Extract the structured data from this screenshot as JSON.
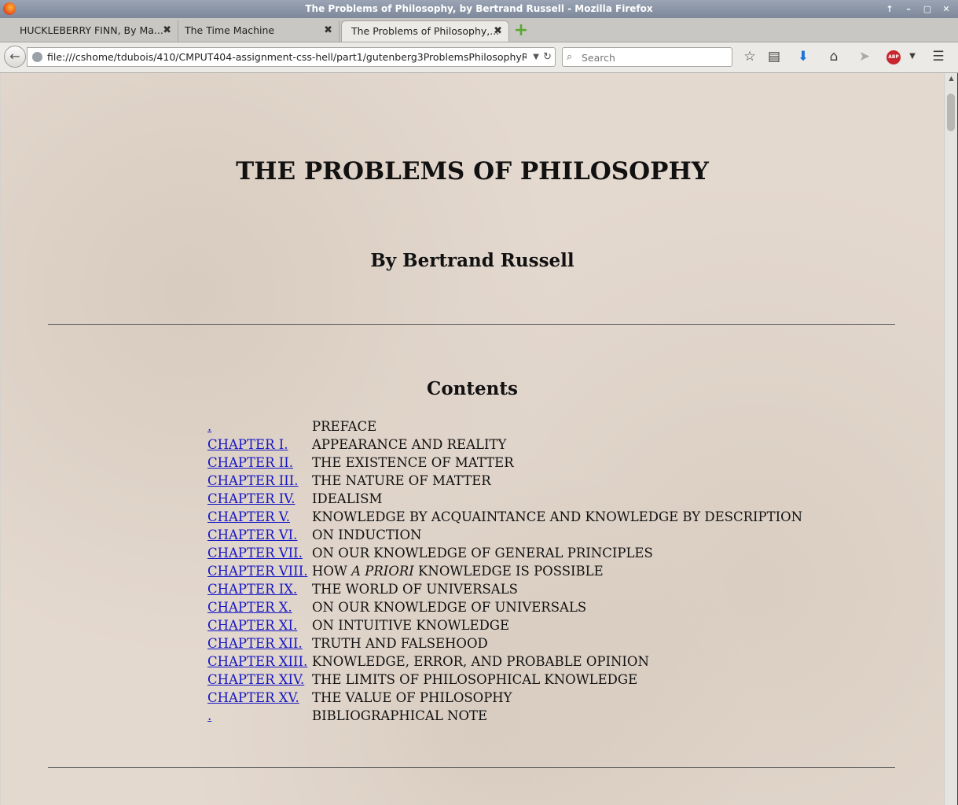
{
  "window": {
    "title": "The Problems of Philosophy, by Bertrand Russell - Mozilla Firefox"
  },
  "tabs": [
    {
      "label": "HUCKLEBERRY FINN, By Ma...",
      "active": false
    },
    {
      "label": "The Time Machine",
      "active": false
    },
    {
      "label": "The Problems of Philosophy,...",
      "active": true
    }
  ],
  "navbar": {
    "url": "file:///cshome/tdubois/410/CMPUT404-assignment-css-hell/part1/gutenberg3ProblemsPhilosophyRussell.ht",
    "search_placeholder": "Search",
    "abp_label": "ABP"
  },
  "page": {
    "title": "THE PROBLEMS OF PHILOSOPHY",
    "author": "By Bertrand Russell",
    "contents_heading": "Contents",
    "toc": [
      {
        "link": ".",
        "title_pre": "PREFACE",
        "title_em": "",
        "title_post": ""
      },
      {
        "link": "CHAPTER I.",
        "title_pre": "APPEARANCE AND REALITY",
        "title_em": "",
        "title_post": ""
      },
      {
        "link": "CHAPTER II.",
        "title_pre": "THE EXISTENCE OF MATTER",
        "title_em": "",
        "title_post": ""
      },
      {
        "link": "CHAPTER III.",
        "title_pre": "THE NATURE OF MATTER",
        "title_em": "",
        "title_post": ""
      },
      {
        "link": "CHAPTER IV.",
        "title_pre": "IDEALISM",
        "title_em": "",
        "title_post": ""
      },
      {
        "link": "CHAPTER V.",
        "title_pre": "KNOWLEDGE BY ACQUAINTANCE AND KNOWLEDGE BY DESCRIPTION",
        "title_em": "",
        "title_post": ""
      },
      {
        "link": "CHAPTER VI.",
        "title_pre": "ON INDUCTION",
        "title_em": "",
        "title_post": ""
      },
      {
        "link": "CHAPTER VII.",
        "title_pre": "ON OUR KNOWLEDGE OF GENERAL PRINCIPLES",
        "title_em": "",
        "title_post": ""
      },
      {
        "link": "CHAPTER VIII.",
        "title_pre": "HOW ",
        "title_em": "A PRIORI",
        "title_post": " KNOWLEDGE IS POSSIBLE"
      },
      {
        "link": "CHAPTER IX.",
        "title_pre": "THE WORLD OF UNIVERSALS",
        "title_em": "",
        "title_post": ""
      },
      {
        "link": "CHAPTER X.",
        "title_pre": "ON OUR KNOWLEDGE OF UNIVERSALS",
        "title_em": "",
        "title_post": ""
      },
      {
        "link": "CHAPTER XI.",
        "title_pre": "ON INTUITIVE KNOWLEDGE",
        "title_em": "",
        "title_post": ""
      },
      {
        "link": "CHAPTER XII.",
        "title_pre": "TRUTH AND FALSEHOOD",
        "title_em": "",
        "title_post": ""
      },
      {
        "link": "CHAPTER XIII.",
        "title_pre": "KNOWLEDGE, ERROR, AND PROBABLE OPINION",
        "title_em": "",
        "title_post": ""
      },
      {
        "link": "CHAPTER XIV.",
        "title_pre": "THE LIMITS OF PHILOSOPHICAL KNOWLEDGE",
        "title_em": "",
        "title_post": ""
      },
      {
        "link": "CHAPTER XV.",
        "title_pre": "THE VALUE OF PHILOSOPHY",
        "title_em": "",
        "title_post": ""
      },
      {
        "link": ".",
        "title_pre": "BIBLIOGRAPHICAL NOTE",
        "title_em": "",
        "title_post": ""
      }
    ]
  },
  "colors": {
    "link": "#1515c4",
    "page_background": "#e4d9cf",
    "titlebar": "#8a94a6"
  }
}
